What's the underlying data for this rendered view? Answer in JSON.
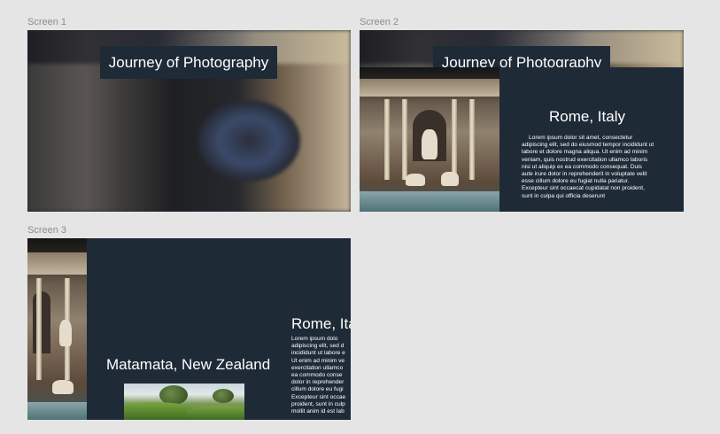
{
  "frames": {
    "screen1": {
      "label": "Screen 1",
      "title": "Journey of Photography"
    },
    "screen2": {
      "label": "Screen 2",
      "title": "Journey of Photography",
      "city": "Rome, Italy",
      "body": "Lorem ipsum dolor sit amet, consectetur adipiscing elit, sed do eiusmod tempor incididunt ut labore et dolore magna aliqua. Ut enim ad minim veniam, quis nostrud exercitation ullamco laboris nisi ut aliquip ex ea commodo consequat. Duis aute irure dolor in reprehenderit in voluptate velit esse cillum dolore eu fugiat nulla pariatur. Excepteur sint occaecat cupidatat non proident, sunt in culpa qui officia deserunt"
    },
    "screen3": {
      "label": "Screen 3",
      "city_primary": "Matamata, New Zealand",
      "city_secondary": "Rome, Ita",
      "body_lines": [
        "Lorem ipsum dolo",
        "adipiscing elit, sed d",
        "incididunt ut labore e",
        "Ut enim ad minim ve",
        "exercitation ullamco",
        "ea commodo conse",
        "dolor in reprehender",
        "cillum dolore eu fugi",
        "Excepteur sint occae",
        "proident, sunt in culp",
        "mollit anim id est lab"
      ]
    }
  },
  "colors": {
    "canvas": "#e5e5e5",
    "panel": "#1f2a37",
    "label": "#8c8c8c",
    "text": "#ffffff"
  }
}
